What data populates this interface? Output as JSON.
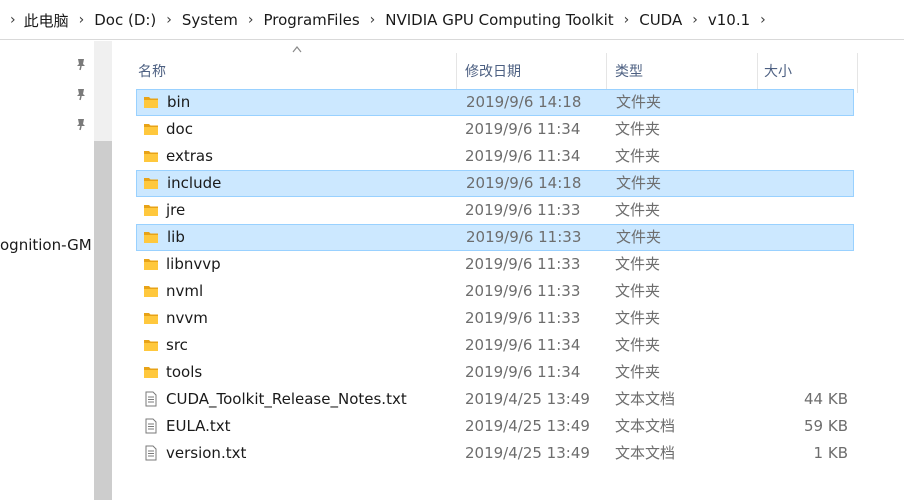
{
  "breadcrumb": {
    "items": [
      "此电脑",
      "Doc (D:)",
      "System",
      "ProgramFiles",
      "NVIDIA GPU Computing Toolkit",
      "CUDA",
      "v10.1"
    ]
  },
  "nav": {
    "truncated_item": "ognition-GM",
    "pin_icon": "pin-icon"
  },
  "columns": {
    "name": "名称",
    "date": "修改日期",
    "type": "类型",
    "size": "大小"
  },
  "files": [
    {
      "name": "bin",
      "date": "2019/9/6 14:18",
      "type": "文件夹",
      "size": "",
      "kind": "folder",
      "selected": true
    },
    {
      "name": "doc",
      "date": "2019/9/6 11:34",
      "type": "文件夹",
      "size": "",
      "kind": "folder",
      "selected": false
    },
    {
      "name": "extras",
      "date": "2019/9/6 11:34",
      "type": "文件夹",
      "size": "",
      "kind": "folder",
      "selected": false
    },
    {
      "name": "include",
      "date": "2019/9/6 14:18",
      "type": "文件夹",
      "size": "",
      "kind": "folder",
      "selected": true
    },
    {
      "name": "jre",
      "date": "2019/9/6 11:33",
      "type": "文件夹",
      "size": "",
      "kind": "folder",
      "selected": false
    },
    {
      "name": "lib",
      "date": "2019/9/6 11:33",
      "type": "文件夹",
      "size": "",
      "kind": "folder",
      "selected": true
    },
    {
      "name": "libnvvp",
      "date": "2019/9/6 11:33",
      "type": "文件夹",
      "size": "",
      "kind": "folder",
      "selected": false
    },
    {
      "name": "nvml",
      "date": "2019/9/6 11:33",
      "type": "文件夹",
      "size": "",
      "kind": "folder",
      "selected": false
    },
    {
      "name": "nvvm",
      "date": "2019/9/6 11:33",
      "type": "文件夹",
      "size": "",
      "kind": "folder",
      "selected": false
    },
    {
      "name": "src",
      "date": "2019/9/6 11:34",
      "type": "文件夹",
      "size": "",
      "kind": "folder",
      "selected": false
    },
    {
      "name": "tools",
      "date": "2019/9/6 11:34",
      "type": "文件夹",
      "size": "",
      "kind": "folder",
      "selected": false
    },
    {
      "name": "CUDA_Toolkit_Release_Notes.txt",
      "date": "2019/4/25 13:49",
      "type": "文本文档",
      "size": "44 KB",
      "kind": "text",
      "selected": false
    },
    {
      "name": "EULA.txt",
      "date": "2019/4/25 13:49",
      "type": "文本文档",
      "size": "59 KB",
      "kind": "text",
      "selected": false
    },
    {
      "name": "version.txt",
      "date": "2019/4/25 13:49",
      "type": "文本文档",
      "size": "1 KB",
      "kind": "text",
      "selected": false
    }
  ],
  "colors": {
    "selection_fill": "#cce8ff",
    "selection_border": "#99d1ff",
    "folder_yellow": "#ffc83d",
    "header_text": "#4d6082"
  }
}
